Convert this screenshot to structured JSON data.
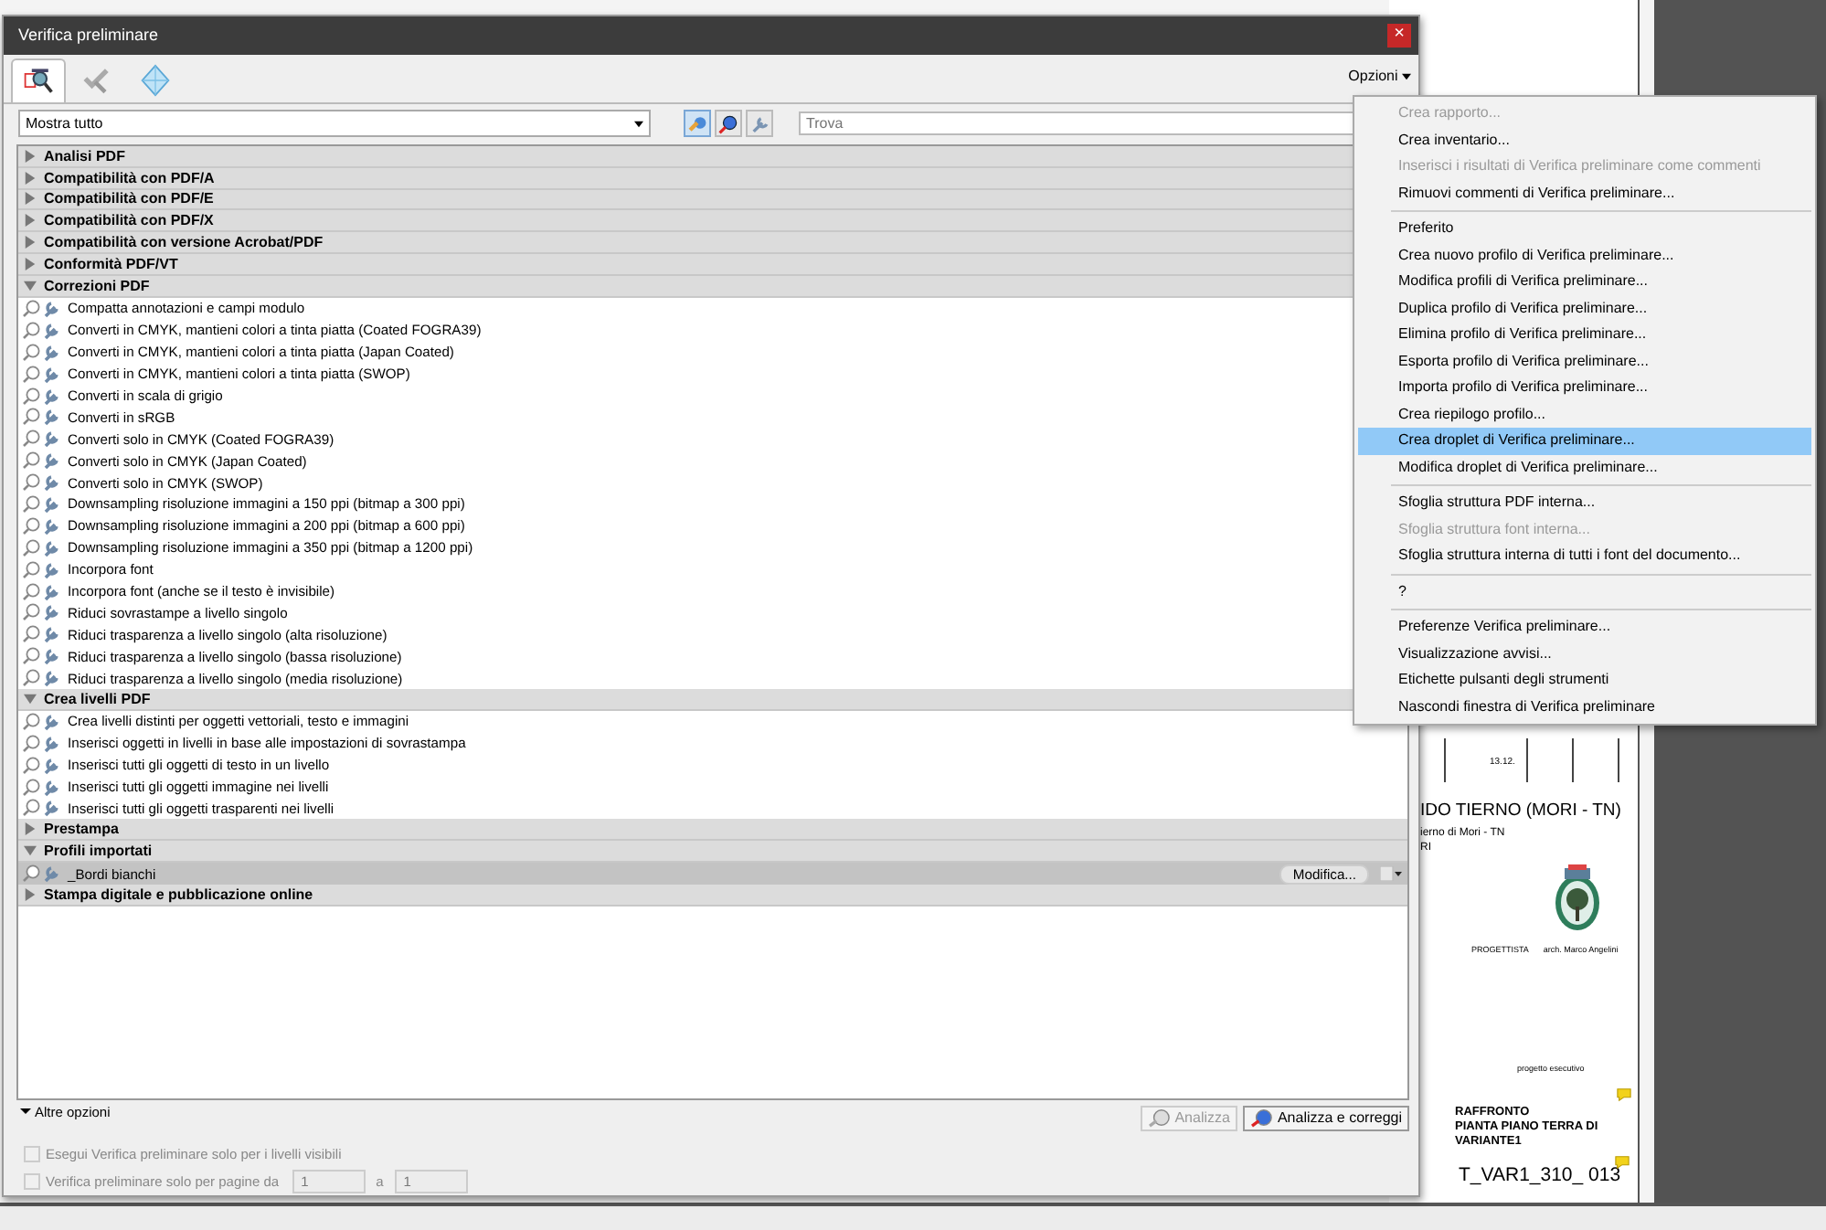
{
  "window": {
    "title": "Verifica preliminare",
    "close": "×"
  },
  "tabs": [
    {
      "selected": true
    },
    {
      "selected": false
    },
    {
      "selected": false
    }
  ],
  "options_button": "Opzioni",
  "filter": {
    "value": "Mostra tutto"
  },
  "search": {
    "placeholder": "Trova"
  },
  "groups": [
    {
      "label": "Analisi PDF",
      "expanded": false
    },
    {
      "label": "Compatibilità con PDF/A",
      "expanded": false
    },
    {
      "label": "Compatibilità con PDF/E",
      "expanded": false
    },
    {
      "label": "Compatibilità con PDF/X",
      "expanded": false
    },
    {
      "label": "Compatibilità con versione Acrobat/PDF",
      "expanded": false
    },
    {
      "label": "Conformità PDF/VT",
      "expanded": false
    },
    {
      "label": "Correzioni PDF",
      "expanded": true,
      "children": [
        {
          "label": "Compatta annotazioni e campi modulo",
          "selected": false
        },
        {
          "label": "Converti in CMYK, mantieni colori a tinta piatta (Coated FOGRA39)",
          "selected": false
        },
        {
          "label": "Converti in CMYK, mantieni colori a tinta piatta (Japan Coated)",
          "selected": false
        },
        {
          "label": "Converti in CMYK, mantieni colori a tinta piatta (SWOP)",
          "selected": false
        },
        {
          "label": "Converti in scala di grigio",
          "selected": false
        },
        {
          "label": "Converti in sRGB",
          "selected": false
        },
        {
          "label": "Converti solo in CMYK (Coated FOGRA39)",
          "selected": false
        },
        {
          "label": "Converti solo in CMYK (Japan Coated)",
          "selected": false
        },
        {
          "label": "Converti solo in CMYK (SWOP)",
          "selected": false
        },
        {
          "label": "Downsampling risoluzione immagini a 150 ppi (bitmap a 300 ppi)",
          "selected": false
        },
        {
          "label": "Downsampling risoluzione immagini a 200 ppi (bitmap a 600 ppi)",
          "selected": false
        },
        {
          "label": "Downsampling risoluzione immagini a 350 ppi (bitmap a 1200 ppi)",
          "selected": false
        },
        {
          "label": "Incorpora font",
          "selected": false
        },
        {
          "label": "Incorpora font (anche se il testo è invisibile)",
          "selected": false
        },
        {
          "label": "Riduci sovrastampe a livello singolo",
          "selected": false
        },
        {
          "label": "Riduci trasparenza a livello singolo (alta risoluzione)",
          "selected": false
        },
        {
          "label": "Riduci trasparenza a livello singolo (bassa risoluzione)",
          "selected": false
        },
        {
          "label": "Riduci trasparenza a livello singolo (media risoluzione)",
          "selected": false
        }
      ]
    },
    {
      "label": "Crea livelli PDF",
      "expanded": true,
      "children": [
        {
          "label": "Crea livelli distinti per oggetti vettoriali, testo e immagini",
          "selected": false
        },
        {
          "label": "Inserisci oggetti in livelli in base alle impostazioni di sovrastampa",
          "selected": false
        },
        {
          "label": "Inserisci tutti gli oggetti di testo in un livello",
          "selected": false
        },
        {
          "label": "Inserisci tutti gli oggetti immagine nei livelli",
          "selected": false
        },
        {
          "label": "Inserisci tutti gli oggetti trasparenti nei livelli",
          "selected": false
        }
      ]
    },
    {
      "label": "Prestampa",
      "expanded": false
    },
    {
      "label": "Profili importati",
      "expanded": true,
      "children": [
        {
          "label": "_Bordi bianchi",
          "selected": true
        }
      ]
    },
    {
      "label": "Stampa digitale e pubblicazione online",
      "expanded": false
    }
  ],
  "modify_button": "Modifica...",
  "more_options": {
    "label": "Altre opzioni",
    "expanded": true
  },
  "checkboxes": [
    {
      "label": "Esegui Verifica preliminare solo per i livelli visibili",
      "checked": false,
      "disabled": true
    },
    {
      "label": "Verifica preliminare solo per pagine da",
      "checked": false,
      "disabled": true
    }
  ],
  "page_range": {
    "from": "1",
    "separator": "a",
    "to": "1"
  },
  "buttons": [
    {
      "label": "Analizza",
      "disabled": true
    },
    {
      "label": "Analizza e correggi",
      "disabled": false
    }
  ],
  "menu": [
    {
      "kind": "item",
      "label": "Crea rapporto...",
      "disabled": true,
      "selected": false
    },
    {
      "kind": "item",
      "label": "Crea inventario...",
      "disabled": false,
      "selected": false
    },
    {
      "kind": "item",
      "label": "Inserisci i risultati di Verifica preliminare come commenti",
      "disabled": true,
      "selected": false
    },
    {
      "kind": "item",
      "label": "Rimuovi commenti di Verifica preliminare...",
      "disabled": false,
      "selected": false
    },
    {
      "kind": "separator"
    },
    {
      "kind": "item",
      "label": "Preferito",
      "disabled": false,
      "selected": false
    },
    {
      "kind": "item",
      "label": "Crea nuovo profilo di Verifica preliminare...",
      "disabled": false,
      "selected": false
    },
    {
      "kind": "item",
      "label": "Modifica profili di Verifica preliminare...",
      "disabled": false,
      "selected": false
    },
    {
      "kind": "item",
      "label": "Duplica profilo di Verifica preliminare...",
      "disabled": false,
      "selected": false
    },
    {
      "kind": "item",
      "label": "Elimina profilo di Verifica preliminare...",
      "disabled": false,
      "selected": false
    },
    {
      "kind": "item",
      "label": "Esporta profilo di Verifica preliminare...",
      "disabled": false,
      "selected": false
    },
    {
      "kind": "item",
      "label": "Importa profilo di Verifica preliminare...",
      "disabled": false,
      "selected": false
    },
    {
      "kind": "item",
      "label": "Crea riepilogo profilo...",
      "disabled": false,
      "selected": false
    },
    {
      "kind": "item",
      "label": "Crea droplet di Verifica preliminare...",
      "disabled": false,
      "selected": true
    },
    {
      "kind": "item",
      "label": "Modifica droplet di Verifica preliminare...",
      "disabled": false,
      "selected": false
    },
    {
      "kind": "separator"
    },
    {
      "kind": "item",
      "label": "Sfoglia struttura PDF interna...",
      "disabled": false,
      "selected": false
    },
    {
      "kind": "item",
      "label": "Sfoglia struttura font interna...",
      "disabled": true,
      "selected": false
    },
    {
      "kind": "item",
      "label": "Sfoglia struttura interna di tutti i font del documento...",
      "disabled": false,
      "selected": false
    },
    {
      "kind": "separator"
    },
    {
      "kind": "item",
      "label": "?",
      "disabled": false,
      "selected": false
    },
    {
      "kind": "separator"
    },
    {
      "kind": "item",
      "label": "Preferenze Verifica preliminare...",
      "disabled": false,
      "selected": false
    },
    {
      "kind": "item",
      "label": "Visualizzazione avvisi...",
      "disabled": false,
      "selected": false
    },
    {
      "kind": "item",
      "label": "Etichette pulsanti degli strumenti",
      "disabled": false,
      "selected": false
    },
    {
      "kind": "item",
      "label": "Nascondi finestra di Verifica preliminare",
      "disabled": false,
      "selected": false
    }
  ],
  "document": {
    "date": "13.12.",
    "title": "IDO TIERNO (MORI - TN)",
    "subtitle": "ierno di Mori - TN",
    "line": "RI",
    "designer_label": "PROGETTISTA",
    "designer": "arch. Marco Angelini",
    "phase": "progetto  esecutivo",
    "sheet_title": [
      "RAFFRONTO",
      "PIANTA PIANO TERRA DI",
      "VARIANTE1"
    ],
    "code": "T_VAR1_310_ 013"
  }
}
